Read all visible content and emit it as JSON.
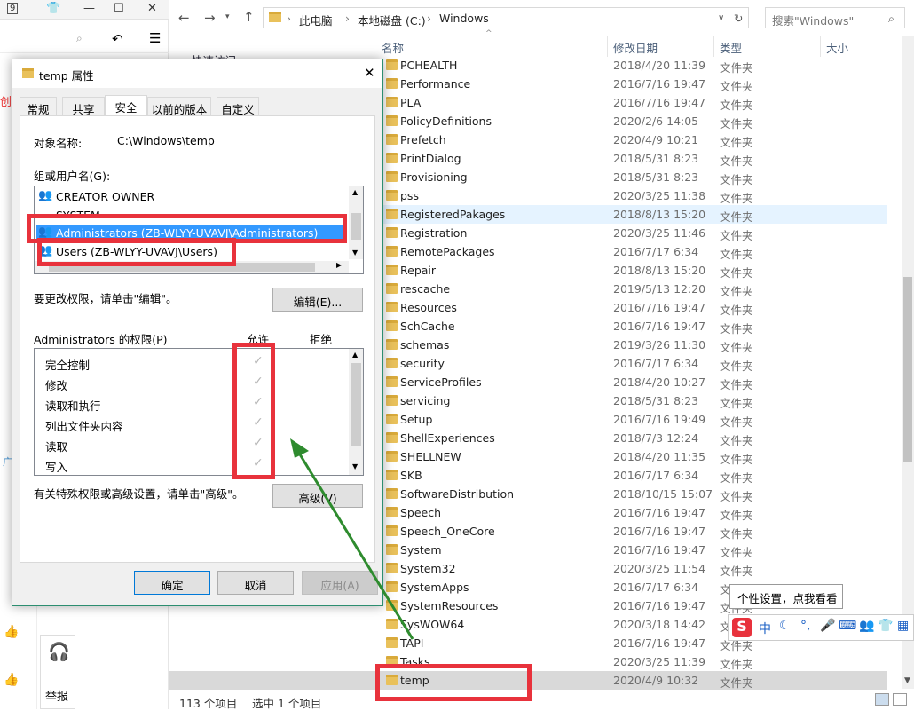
{
  "bg_app": {
    "tab_num": "9",
    "red_char": "创",
    "ad_char": "广",
    "report_label": "举报"
  },
  "explorer": {
    "breadcrumb": [
      "此电脑",
      "本地磁盘 (C:)",
      "Windows"
    ],
    "search_placeholder": "搜索\"Windows\"",
    "quick_access": "快速访问",
    "columns": {
      "name": "名称",
      "date": "修改日期",
      "type": "类型",
      "size": "大小"
    },
    "files": [
      {
        "name": "PCHEALTH",
        "date": "2018/4/20 11:39",
        "type": "文件夹"
      },
      {
        "name": "Performance",
        "date": "2016/7/16 19:47",
        "type": "文件夹"
      },
      {
        "name": "PLA",
        "date": "2016/7/16 19:47",
        "type": "文件夹"
      },
      {
        "name": "PolicyDefinitions",
        "date": "2020/2/6 14:05",
        "type": "文件夹"
      },
      {
        "name": "Prefetch",
        "date": "2020/4/9 10:21",
        "type": "文件夹"
      },
      {
        "name": "PrintDialog",
        "date": "2018/5/31 8:23",
        "type": "文件夹"
      },
      {
        "name": "Provisioning",
        "date": "2018/5/31 8:23",
        "type": "文件夹"
      },
      {
        "name": "pss",
        "date": "2020/3/25 11:38",
        "type": "文件夹"
      },
      {
        "name": "RegisteredPakages",
        "date": "2018/8/13 15:20",
        "type": "文件夹"
      },
      {
        "name": "Registration",
        "date": "2020/3/25 11:46",
        "type": "文件夹"
      },
      {
        "name": "RemotePackages",
        "date": "2016/7/17 6:34",
        "type": "文件夹"
      },
      {
        "name": "Repair",
        "date": "2018/8/13 15:20",
        "type": "文件夹"
      },
      {
        "name": "rescache",
        "date": "2019/5/13 12:20",
        "type": "文件夹"
      },
      {
        "name": "Resources",
        "date": "2016/7/16 19:47",
        "type": "文件夹"
      },
      {
        "name": "SchCache",
        "date": "2016/7/16 19:47",
        "type": "文件夹"
      },
      {
        "name": "schemas",
        "date": "2019/3/26 11:30",
        "type": "文件夹"
      },
      {
        "name": "security",
        "date": "2016/7/17 6:34",
        "type": "文件夹"
      },
      {
        "name": "ServiceProfiles",
        "date": "2018/4/20 10:27",
        "type": "文件夹"
      },
      {
        "name": "servicing",
        "date": "2018/5/31 8:23",
        "type": "文件夹"
      },
      {
        "name": "Setup",
        "date": "2016/7/16 19:49",
        "type": "文件夹"
      },
      {
        "name": "ShellExperiences",
        "date": "2018/7/3 12:24",
        "type": "文件夹"
      },
      {
        "name": "SHELLNEW",
        "date": "2018/4/20 11:35",
        "type": "文件夹"
      },
      {
        "name": "SKB",
        "date": "2016/7/17 6:34",
        "type": "文件夹"
      },
      {
        "name": "SoftwareDistribution",
        "date": "2018/10/15 15:07",
        "type": "文件夹"
      },
      {
        "name": "Speech",
        "date": "2016/7/16 19:47",
        "type": "文件夹"
      },
      {
        "name": "Speech_OneCore",
        "date": "2016/7/16 19:47",
        "type": "文件夹"
      },
      {
        "name": "System",
        "date": "2016/7/16 19:47",
        "type": "文件夹"
      },
      {
        "name": "System32",
        "date": "2020/3/25 11:54",
        "type": "文件夹"
      },
      {
        "name": "SystemApps",
        "date": "2016/7/17 6:34",
        "type": "文件夹"
      },
      {
        "name": "SystemResources",
        "date": "2016/7/16 19:47",
        "type": "文件夹"
      },
      {
        "name": "SysWOW64",
        "date": "2020/3/18 14:42",
        "type": "文件夹"
      },
      {
        "name": "TAPI",
        "date": "2016/7/16 19:47",
        "type": "文件夹"
      },
      {
        "name": "Tasks",
        "date": "2020/3/25 11:39",
        "type": "文件夹"
      },
      {
        "name": "temp",
        "date": "2020/4/9 10:32",
        "type": "文件夹"
      }
    ],
    "status_count": "113 个项目",
    "status_selected": "选中 1 个项目"
  },
  "dialog": {
    "title": "temp 属性",
    "tabs": [
      "常规",
      "共享",
      "安全",
      "以前的版本",
      "自定义"
    ],
    "object_label": "对象名称:",
    "object_value": "C:\\Windows\\temp",
    "group_label": "组或用户名(G):",
    "users": [
      "CREATOR OWNER",
      "SYSTEM",
      "Administrators (ZB-WLYY-UVAVJ\\Administrators)",
      "Users (ZB-WLYY-UVAVJ\\Users)"
    ],
    "edit_hint": "要更改权限，请单击\"编辑\"。",
    "edit_button": "编辑(E)...",
    "perm_label": "Administrators 的权限(P)",
    "allow_header": "允许",
    "deny_header": "拒绝",
    "permissions": [
      "完全控制",
      "修改",
      "读取和执行",
      "列出文件夹内容",
      "读取",
      "写入"
    ],
    "check_glyph": "✓",
    "advanced_hint": "有关特殊权限或高级设置，请单击\"高级\"。",
    "advanced_button": "高级(V)",
    "ok_button": "确定",
    "cancel_button": "取消",
    "apply_button": "应用(A)"
  },
  "ime": {
    "tooltip": "个性设置，点我看看",
    "logo": "S",
    "mode": "中"
  },
  "colors": {
    "highlight": "#3399ff",
    "red_box": "#e8323c",
    "arrow": "#2e8b2e"
  }
}
